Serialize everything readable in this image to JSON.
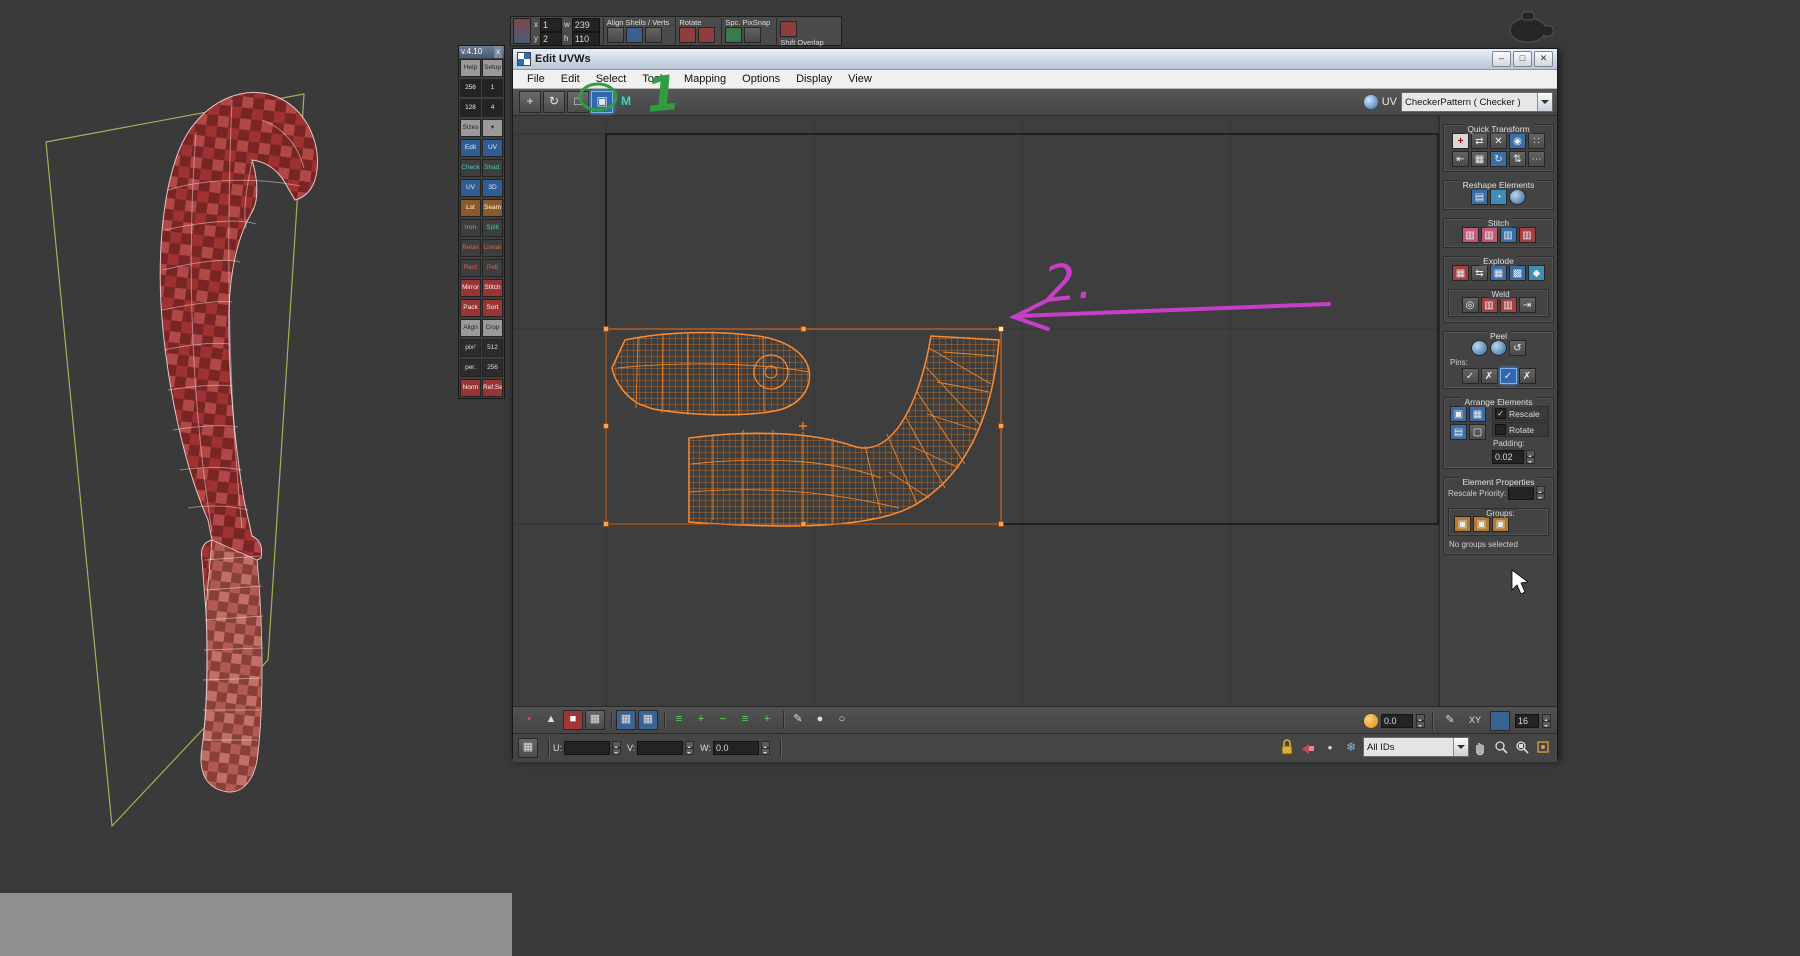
{
  "window": {
    "title": "Edit UVWs",
    "menu": [
      "File",
      "Edit",
      "Select",
      "Tools",
      "Mapping",
      "Options",
      "Display",
      "View"
    ],
    "uv_label": "UV",
    "pattern": "CheckerPattern  ( Checker )"
  },
  "glyphs": {
    "min": "–",
    "max": "□",
    "close": "✕",
    "move": "+",
    "rotate": "↻",
    "scale": "□",
    "freeform": "▣",
    "mirror": "M",
    "vertex": "•",
    "edge": "▲",
    "face": "■",
    "element": "▦",
    "cube": "▦",
    "plus": "+",
    "minus": "−",
    "lines": "≡",
    "pencil": "✎",
    "dot": "●",
    "circle": "○",
    "target": "◎",
    "check": "✓",
    "snowflake": "❄"
  },
  "float_toolbar": {
    "x_label": "x",
    "y_label": "y",
    "w_label": "w",
    "h_label": "h",
    "x": "1",
    "y": "2",
    "w": "239",
    "h": "110",
    "group_align": "Align Shells / Verts",
    "group_rotate": "Rotate",
    "group_snap": "Spc. PixSnap",
    "overlap": "Shift Overlap"
  },
  "script_panel": {
    "version": "v.4.10",
    "close": "x",
    "rows": [
      [
        "Help",
        "Setup"
      ],
      [
        "256",
        "1"
      ],
      [
        "128",
        "4"
      ],
      [
        "Sizes",
        "▾"
      ],
      [
        "Edit",
        "UV"
      ],
      [
        "Check",
        "Shad."
      ],
      [
        "UV",
        "3D"
      ],
      [
        "Lst",
        "Seam"
      ],
      [
        "Iron",
        "Split"
      ],
      [
        "Relax",
        "Linear"
      ],
      [
        "Rect",
        "Pelt"
      ],
      [
        "Mirror",
        "Stitch"
      ],
      [
        "Pack",
        "Sort"
      ],
      [
        "Align",
        "Crop"
      ],
      [
        "pix²",
        "512"
      ],
      [
        "per.",
        "256"
      ],
      [
        "Norm",
        "Ref.Set"
      ]
    ]
  },
  "right_panel": {
    "quick_transform": "Quick Transform",
    "reshape": "Reshape Elements",
    "stitch": "Stitch",
    "explode": "Explode",
    "weld": "Weld",
    "peel": "Peel",
    "pins": "Pins:",
    "arrange": "Arrange Elements",
    "rescale": "Rescale",
    "rotate": "Rotate",
    "padding_label": "Padding:",
    "padding_value": "0.02",
    "element_properties": "Element Properties",
    "rescale_priority": "Rescale Priority:",
    "groups_label": "Groups:",
    "no_groups": "No groups selected"
  },
  "bottom_bar": {
    "soft_value": "0.0",
    "xy": "XY",
    "grid_value": "16"
  },
  "status_bar": {
    "u": "U:",
    "v": "V:",
    "w": "W:",
    "w_value": "0.0",
    "ids": "All IDs"
  },
  "annotations": {
    "step1": "1",
    "step2": "2."
  }
}
